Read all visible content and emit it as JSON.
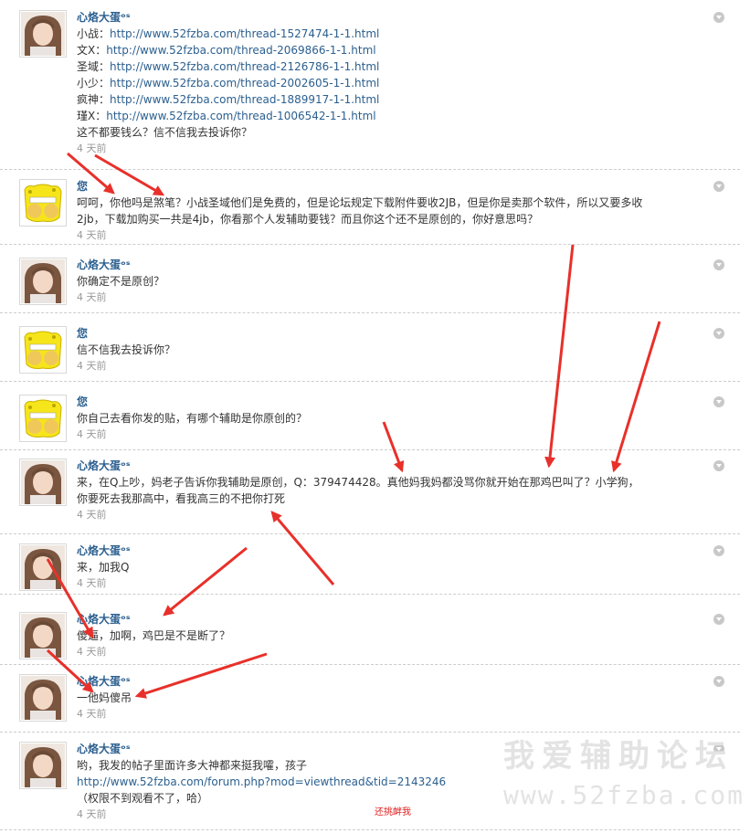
{
  "feed": {
    "delete_icon": "chevron-down-icon",
    "messages": [
      {
        "author": "心烙大蛋ᵒˢ",
        "avatar": "girl",
        "lines": [
          {
            "label": "小战：",
            "link": "http://www.52fzba.com/thread-1527474-1-1.html"
          },
          {
            "label": "文X：",
            "link": "http://www.52fzba.com/thread-2069866-1-1.html"
          },
          {
            "label": "圣域：",
            "link": "http://www.52fzba.com/thread-2126786-1-1.html"
          },
          {
            "label": "小少：",
            "link": "http://www.52fzba.com/thread-2002605-1-1.html"
          },
          {
            "label": "疯神：",
            "link": "http://www.52fzba.com/thread-1889917-1-1.html"
          },
          {
            "label": "瑾X：",
            "link": "http://www.52fzba.com/thread-1006542-1-1.html"
          },
          {
            "label": "这不都要钱么？信不信我去投诉你？",
            "link": ""
          }
        ],
        "time": "4 天前"
      },
      {
        "author": "您",
        "avatar": "sponge",
        "lines": [
          {
            "label": "呵呵，你他吗是煞笔？小战圣域他们是免费的，但是论坛规定下载附件要收2JB，但是你是卖那个软件，所以又要多收",
            "link": ""
          },
          {
            "label": "2jb，下载加购买一共是4jb，你看那个人发辅助要钱？而且你这个还不是原创的，你好意思吗？",
            "link": ""
          }
        ],
        "time": "4 天前"
      },
      {
        "author": "心烙大蛋ᵒˢ",
        "avatar": "girl",
        "lines": [
          {
            "label": "你确定不是原创？",
            "link": ""
          }
        ],
        "time": "4 天前"
      },
      {
        "author": "您",
        "avatar": "sponge",
        "lines": [
          {
            "label": "信不信我去投诉你？",
            "link": ""
          }
        ],
        "time": "4 天前"
      },
      {
        "author": "您",
        "avatar": "sponge",
        "lines": [
          {
            "label": "你自己去看你发的贴，有哪个辅助是你原创的？",
            "link": ""
          }
        ],
        "time": "4 天前"
      },
      {
        "author": "心烙大蛋ᵒˢ",
        "avatar": "girl",
        "lines": [
          {
            "label": "来，在Q上吵，妈老子告诉你我辅助是原创，Q：379474428。真他妈我妈都没骂你就开始在那鸡巴叫了？小学狗，",
            "link": ""
          },
          {
            "label": "你要死去我那高中，看我高三的不把你打死",
            "link": ""
          }
        ],
        "time": "4 天前"
      },
      {
        "author": "心烙大蛋ᵒˢ",
        "avatar": "girl",
        "lines": [
          {
            "label": "来，加我Q",
            "link": ""
          }
        ],
        "time": "4 天前"
      },
      {
        "author": "心烙大蛋ᵒˢ",
        "avatar": "girl",
        "lines": [
          {
            "label": "傻逼，加啊，鸡巴是不是断了？",
            "link": ""
          }
        ],
        "time": "4 天前"
      },
      {
        "author": "心烙大蛋ᵒˢ",
        "avatar": "girl",
        "lines": [
          {
            "label": "一他妈傻吊",
            "link": ""
          }
        ],
        "time": "4 天前"
      },
      {
        "author": "心烙大蛋ᵒˢ",
        "avatar": "girl",
        "lines": [
          {
            "label": "哟，我发的帖子里面许多大神都来挺我嚯，孩子",
            "link": ""
          },
          {
            "label": "",
            "link": "http://www.52fzba.com/forum.php?mod=viewthread&tid=2143246"
          },
          {
            "label": "（权限不到观看不了，哈）",
            "link": ""
          }
        ],
        "time": "4 天前"
      }
    ]
  },
  "watermark": {
    "cn": "我爱辅助论坛",
    "en": "www.52fzba.com"
  },
  "annotation": "还挑衅我",
  "colors": {
    "author": "#2b5f8f",
    "link": "#2b5f8f",
    "time": "#999999",
    "arrow": "#e8302a",
    "annotation": "#e02020"
  }
}
